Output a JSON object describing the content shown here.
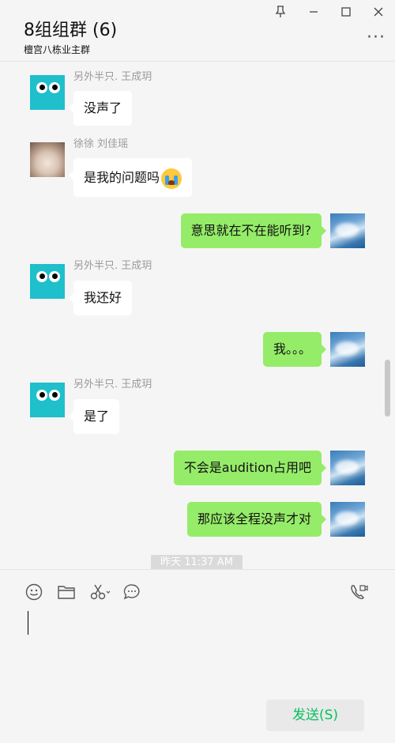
{
  "header": {
    "title": "8组组群 (6)",
    "subtitle": "檀宫八栋业主群",
    "window_controls": [
      "pin-icon",
      "minimize-icon",
      "maximize-icon",
      "close-icon"
    ],
    "more_label": "···"
  },
  "messages": [
    {
      "direction": "in",
      "sender": "另外半只. 王成玥",
      "avatar": "cyan-eyes",
      "text": "没声了"
    },
    {
      "direction": "in",
      "sender": "徐徐 刘佳瑶",
      "avatar": "cat-photo",
      "text": "是我的问题吗",
      "emoji": "crying-face"
    },
    {
      "direction": "out",
      "avatar": "sky-photo",
      "text": "意思就在不在能听到?"
    },
    {
      "direction": "in",
      "sender": "另外半只. 王成玥",
      "avatar": "cyan-eyes",
      "text": "我还好"
    },
    {
      "direction": "out",
      "avatar": "sky-photo",
      "text": "我。。。"
    },
    {
      "direction": "in",
      "sender": "另外半只. 王成玥",
      "avatar": "cyan-eyes",
      "text": "是了"
    },
    {
      "direction": "out",
      "avatar": "sky-photo",
      "text": "不会是audition占用吧"
    },
    {
      "direction": "out",
      "avatar": "sky-photo",
      "text": "那应该全程没声才对"
    }
  ],
  "timestamp": "昨天 11:37 AM",
  "toolbar": {
    "icons": [
      "emoji-icon",
      "folder-icon",
      "scissors-icon",
      "chat-bubble-icon",
      "voice-video-call-icon"
    ]
  },
  "input": {
    "value": ""
  },
  "send_button": {
    "label": "发送(S)"
  },
  "colors": {
    "outgoing_bubble": "#95ec69",
    "incoming_bubble": "#ffffff",
    "send_text": "#07c160",
    "background": "#f5f5f5"
  }
}
